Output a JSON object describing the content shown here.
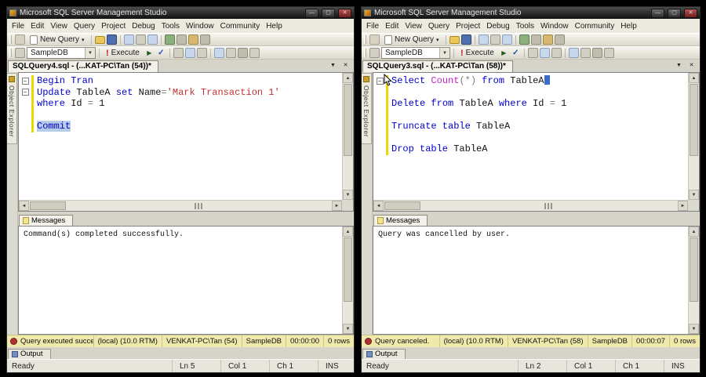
{
  "colors": {
    "keyword": "#0000cc",
    "string": "#c03232",
    "function": "#c820c8",
    "operator": "#7a7a7a",
    "selection": "#b6cce8",
    "cursor": "#3b6cc8",
    "change_bar": "#eed700",
    "status_bar_bg": "#efe9ab",
    "status_icon": "#b23030"
  },
  "icons": {
    "minimize": "—",
    "maximize": "▢",
    "close": "✕",
    "dropdown": "▼",
    "tab_close": "✕",
    "combo_arrow": "▼",
    "scroll_up": "▲",
    "scroll_down": "▼",
    "scroll_left": "◄",
    "scroll_right": "►",
    "fold_collapse": "−",
    "execute_excl": "!",
    "play": "▶",
    "check": "✓",
    "new_query_dropdown": "▾"
  },
  "windows": [
    {
      "title": "Microsoft SQL Server Management Studio",
      "menu": [
        "File",
        "Edit",
        "View",
        "Query",
        "Project",
        "Debug",
        "Tools",
        "Window",
        "Community",
        "Help"
      ],
      "toolbar": {
        "new_query": "New Query",
        "database": "SampleDB",
        "execute": "Execute"
      },
      "tab_title": "SQLQuery4.sql - (...KAT-PC\\Tan (54))*",
      "side_tab": "Object Explorer",
      "editor": {
        "lines": [
          {
            "fold": "-",
            "mark": true,
            "segments": [
              {
                "t": "Begin Tran",
                "c": "kw"
              }
            ]
          },
          {
            "fold": "-",
            "mark": true,
            "segments": [
              {
                "t": "Update ",
                "c": "kw"
              },
              {
                "t": "TableA ",
                "c": "id"
              },
              {
                "t": "set ",
                "c": "kw"
              },
              {
                "t": "Name",
                "c": "id"
              },
              {
                "t": "=",
                "c": "op"
              },
              {
                "t": "'Mark Transaction 1'",
                "c": "str"
              }
            ]
          },
          {
            "mark": true,
            "segments": [
              {
                "t": "where ",
                "c": "kw"
              },
              {
                "t": "Id ",
                "c": "id"
              },
              {
                "t": "= ",
                "c": "op"
              },
              {
                "t": "1",
                "c": "id"
              }
            ]
          },
          {
            "mark": true,
            "segments": []
          },
          {
            "mark": true,
            "segments": [
              {
                "t": "Commit",
                "c": "kw",
                "sel": true
              }
            ]
          }
        ]
      },
      "messages": {
        "tab": "Messages",
        "text": "Command(s) completed successfully."
      },
      "status": {
        "message": "Query executed successfully.",
        "server": "(local) (10.0 RTM)",
        "user": "VENKAT-PC\\Tan (54)",
        "db": "SampleDB",
        "time": "00:00:00",
        "rows": "0 rows"
      },
      "output_tab": "Output",
      "bottom": {
        "ready": "Ready",
        "ln": "Ln 5",
        "col": "Col 1",
        "ch": "Ch 1",
        "ins": "INS"
      }
    },
    {
      "title": "Microsoft SQL Server Management Studio",
      "menu": [
        "File",
        "Edit",
        "View",
        "Query",
        "Project",
        "Debug",
        "Tools",
        "Window",
        "Community",
        "Help"
      ],
      "toolbar": {
        "new_query": "New Query",
        "database": "SampleDB",
        "execute": "Execute"
      },
      "tab_title": "SQLQuery3.sql - (...KAT-PC\\Tan (58))*",
      "side_tab": "Object Explorer",
      "editor": {
        "lines": [
          {
            "fold": "-",
            "mark": true,
            "cursor": true,
            "segments": [
              {
                "t": "Select ",
                "c": "kw"
              },
              {
                "t": "Count",
                "c": "fn"
              },
              {
                "t": "(*) ",
                "c": "op"
              },
              {
                "t": "from ",
                "c": "kw"
              },
              {
                "t": "TableA",
                "c": "id"
              }
            ]
          },
          {
            "mark": true,
            "segments": []
          },
          {
            "mark": true,
            "segments": [
              {
                "t": "Delete ",
                "c": "kw"
              },
              {
                "t": "from ",
                "c": "kw"
              },
              {
                "t": "TableA ",
                "c": "id"
              },
              {
                "t": "where ",
                "c": "kw"
              },
              {
                "t": "Id ",
                "c": "id"
              },
              {
                "t": "= ",
                "c": "op"
              },
              {
                "t": "1",
                "c": "id"
              }
            ]
          },
          {
            "mark": true,
            "segments": []
          },
          {
            "mark": true,
            "segments": [
              {
                "t": "Truncate table ",
                "c": "kw"
              },
              {
                "t": "TableA",
                "c": "id"
              }
            ]
          },
          {
            "mark": true,
            "segments": []
          },
          {
            "mark": true,
            "segments": [
              {
                "t": "Drop table ",
                "c": "kw"
              },
              {
                "t": "TableA",
                "c": "id"
              }
            ]
          }
        ]
      },
      "messages": {
        "tab": "Messages",
        "text": "Query was cancelled by user."
      },
      "status": {
        "message": "Query canceled.",
        "server": "(local) (10.0 RTM)",
        "user": "VENKAT-PC\\Tan (58)",
        "db": "SampleDB",
        "time": "00:00:07",
        "rows": "0 rows"
      },
      "output_tab": "Output",
      "bottom": {
        "ready": "Ready",
        "ln": "Ln 2",
        "col": "Col 1",
        "ch": "Ch 1",
        "ins": "INS"
      }
    }
  ]
}
